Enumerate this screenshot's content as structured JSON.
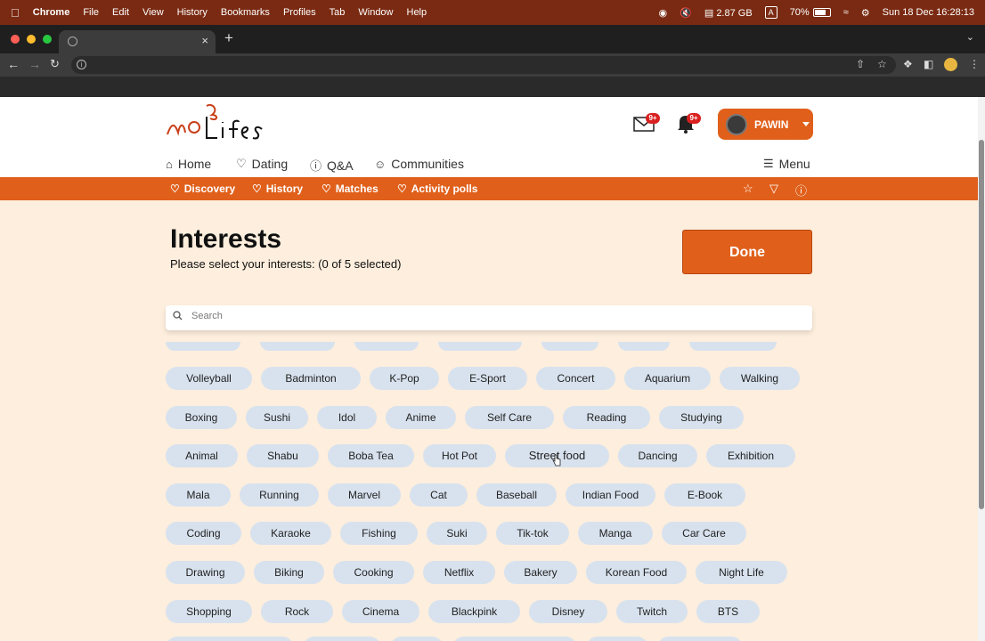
{
  "menubar": {
    "apple": "",
    "app": "Chrome",
    "menus": [
      "File",
      "Edit",
      "View",
      "History",
      "Bookmarks",
      "Profiles",
      "Tab",
      "Window",
      "Help"
    ],
    "memory": "2.87 GB",
    "input_source": "A",
    "battery": "70%",
    "clock": "Sun 18 Dec  16:28:13"
  },
  "browser": {
    "tab_close": "×",
    "new_tab": "+"
  },
  "header": {
    "mail_badge": "9+",
    "bell_badge": "9+",
    "username": "PAWIN"
  },
  "mainnav": {
    "home": "Home",
    "dating": "Dating",
    "qa": "Q&A",
    "communities": "Communities",
    "menu": "Menu"
  },
  "subnav": {
    "discovery": "Discovery",
    "history": "History",
    "matches": "Matches",
    "activity_polls": "Activity polls"
  },
  "page": {
    "title": "Interests",
    "subtitle": "Please select your interests: (0 of 5 selected)",
    "done": "Done",
    "search_placeholder": "Search"
  },
  "interests": [
    [
      "Volleyball",
      "Badminton",
      "K-Pop",
      "E-Sport",
      "Concert",
      "Aquarium",
      "Walking"
    ],
    [
      "Boxing",
      "Sushi",
      "Idol",
      "Anime",
      "Self Care",
      "Reading",
      "Studying"
    ],
    [
      "Animal",
      "Shabu",
      "Boba Tea",
      "Hot Pot",
      "Street food",
      "Dancing",
      "Exhibition"
    ],
    [
      "Mala",
      "Running",
      "Marvel",
      "Cat",
      "Baseball",
      "Indian Food",
      "E-Book"
    ],
    [
      "Coding",
      "Karaoke",
      "Fishing",
      "Suki",
      "Tik-tok",
      "Manga",
      "Car Care"
    ],
    [
      "Drawing",
      "Biking",
      "Cooking",
      "Netflix",
      "Bakery",
      "Korean Food",
      "Night Life"
    ],
    [
      "Shopping",
      "Rock",
      "Cinema",
      "Blackpink",
      "Disney",
      "Twitch",
      "BTS"
    ]
  ],
  "colors": {
    "accent": "#e0601b",
    "chip": "#d8e2ee",
    "page_bg": "#fdeedd"
  }
}
